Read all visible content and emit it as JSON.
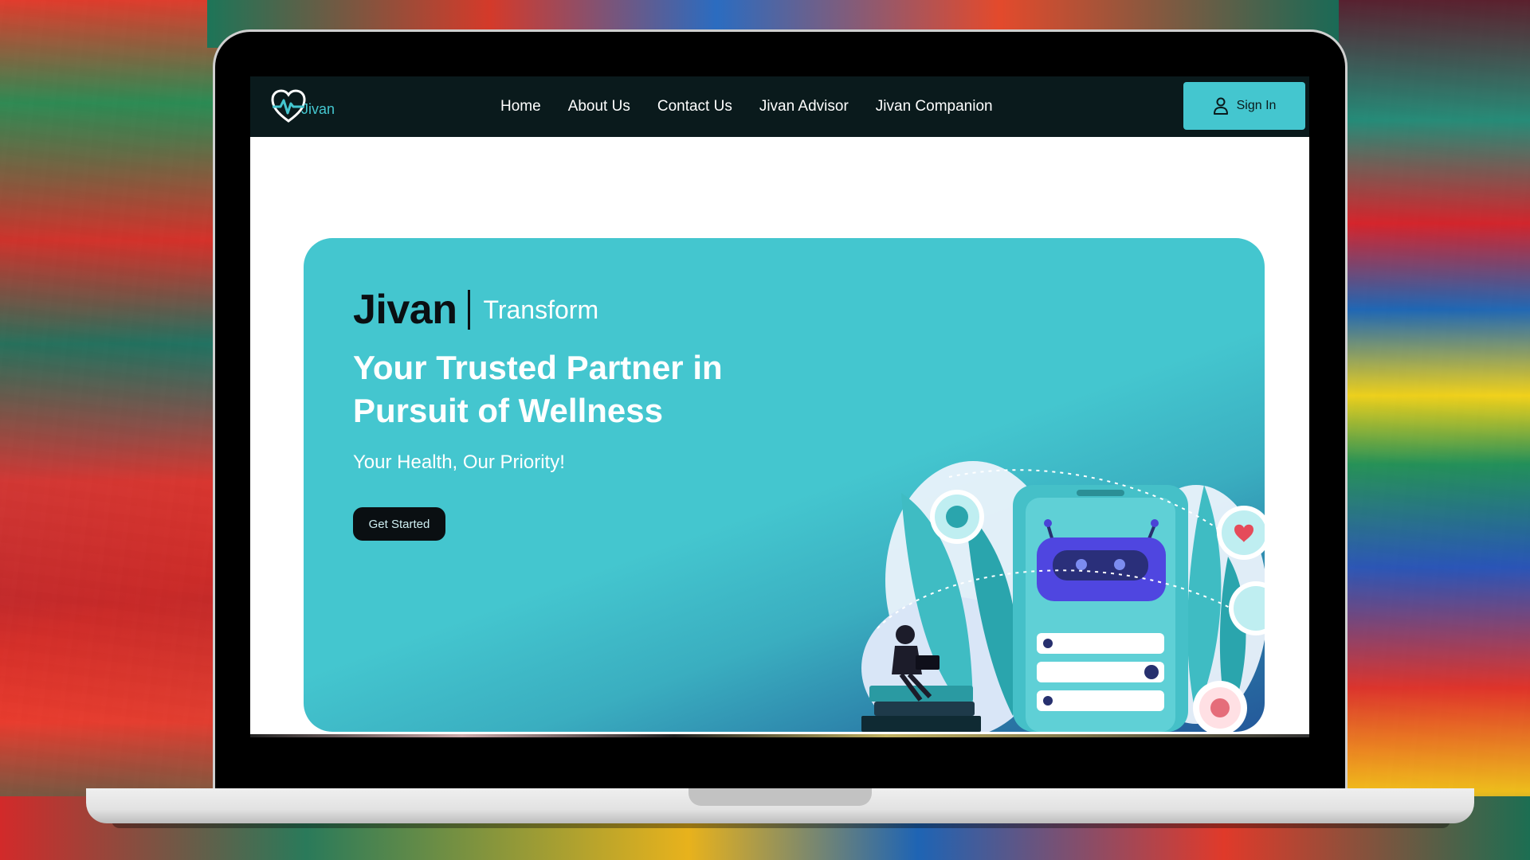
{
  "brand": {
    "logo_text": "Jivan",
    "accent": "#44c6cf",
    "nav_bg": "#0a1a1c"
  },
  "nav": {
    "links": [
      {
        "label": "Home"
      },
      {
        "label": "About Us"
      },
      {
        "label": "Contact Us"
      },
      {
        "label": "Jivan Advisor"
      },
      {
        "label": "Jivan Companion"
      }
    ],
    "signin_label": "Sign In",
    "signin_icon": "user-icon"
  },
  "hero": {
    "brand_name": "Jivan",
    "brand_sub": "Transform",
    "headline": "Your Trusted Partner in Pursuit of Wellness",
    "tagline": "Your Health, Our Priority!",
    "cta_label": "Get Started",
    "illustration_icon": "chatbot-assistant-illustration"
  }
}
